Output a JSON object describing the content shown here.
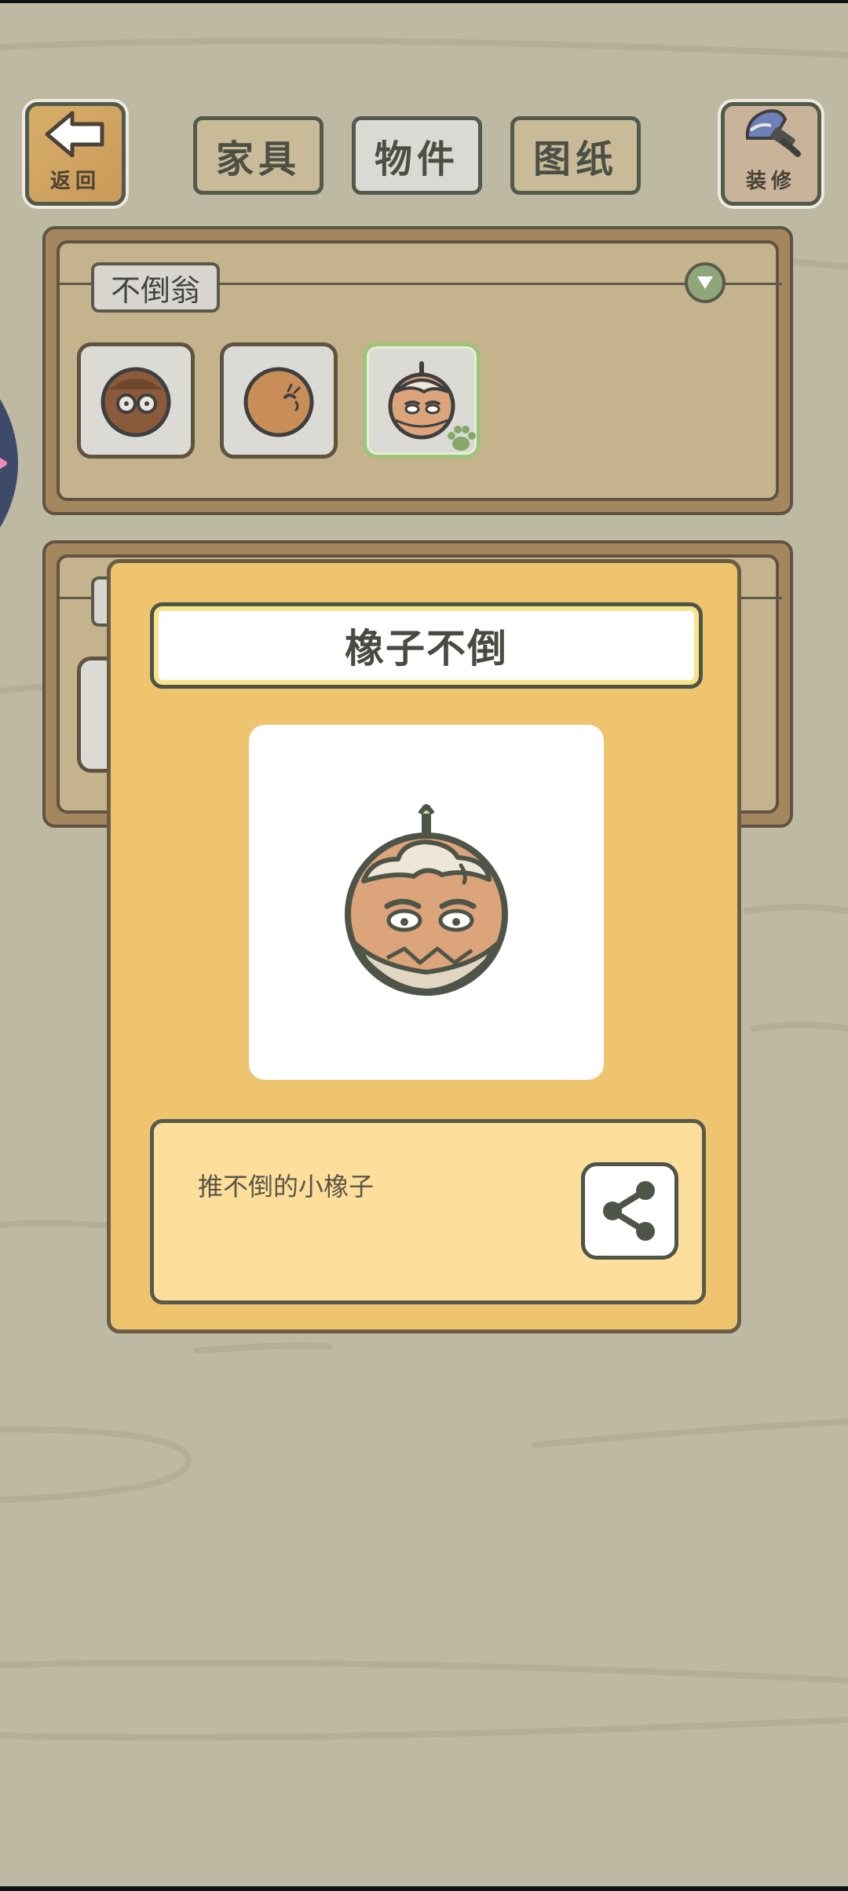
{
  "header": {
    "back_label": "返回",
    "decor_label": "装修",
    "tabs": [
      {
        "label": "家具",
        "active": false
      },
      {
        "label": "物件",
        "active": true
      },
      {
        "label": "图纸",
        "active": false
      }
    ]
  },
  "category": {
    "label": "不倒翁"
  },
  "items": [
    {
      "icon": "acorn-glasses-icon",
      "selected": false
    },
    {
      "icon": "acorn-smile-icon",
      "selected": false
    },
    {
      "icon": "acorn-tumbler-icon",
      "selected": true
    }
  ],
  "popup": {
    "title": "橡子不倒",
    "description": "推不倒的小橡子",
    "icon": "acorn-tumbler-icon",
    "share_icon": "share-icon"
  },
  "colors": {
    "background": "#bdb9a3",
    "panel": "#c5b38d",
    "popup": "#eec46f",
    "desc": "#fddf9b",
    "selected_border": "#9fc27c"
  }
}
